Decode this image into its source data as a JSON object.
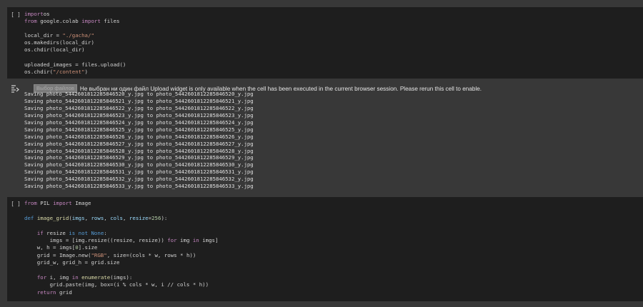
{
  "cell1": {
    "run_label": "[ ]",
    "lines": [
      [
        [
          "kw",
          "import"
        ],
        [
          "",
          "os"
        ]
      ],
      [
        [
          "kw",
          "from"
        ],
        [
          "",
          " google.colab "
        ],
        [
          "kw",
          "import"
        ],
        [
          "",
          " files"
        ]
      ],
      [],
      [
        [
          "",
          "local_dir = "
        ],
        [
          "str",
          "\"./gacha/\""
        ]
      ],
      [
        [
          "",
          "os.makedirs(local_dir)"
        ]
      ],
      [
        [
          "",
          "os.chdir(local_dir)"
        ]
      ],
      [],
      [
        [
          "",
          "uploaded_images = files.upload()"
        ]
      ],
      [
        [
          "",
          "os.chdir("
        ],
        [
          "str",
          "\"/content\""
        ],
        [
          "",
          ")"
        ]
      ]
    ]
  },
  "output": {
    "file_button": "Выбор файлов",
    "file_status": "Не выбран ни один файл",
    "upload_message": "Upload widget is only available when the cell has been executed in the current browser session. Please rerun this cell to enable.",
    "saving_lines": [
      "Saving photo_5442601812285846520_y.jpg to photo_5442601812285846520_y.jpg",
      "Saving photo_5442601812285846521_y.jpg to photo_5442601812285846521_y.jpg",
      "Saving photo_5442601812285846522_y.jpg to photo_5442601812285846522_y.jpg",
      "Saving photo_5442601812285846523_y.jpg to photo_5442601812285846523_y.jpg",
      "Saving photo_5442601812285846524_y.jpg to photo_5442601812285846524_y.jpg",
      "Saving photo_5442601812285846525_y.jpg to photo_5442601812285846525_y.jpg",
      "Saving photo_5442601812285846526_y.jpg to photo_5442601812285846526_y.jpg",
      "Saving photo_5442601812285846527_y.jpg to photo_5442601812285846527_y.jpg",
      "Saving photo_5442601812285846528_y.jpg to photo_5442601812285846528_y.jpg",
      "Saving photo_5442601812285846529_y.jpg to photo_5442601812285846529_y.jpg",
      "Saving photo_5442601812285846530_y.jpg to photo_5442601812285846530_y.jpg",
      "Saving photo_5442601812285846531_y.jpg to photo_5442601812285846531_y.jpg",
      "Saving photo_5442601812285846532_y.jpg to photo_5442601812285846532_y.jpg",
      "Saving photo_5442601812285846533_y.jpg to photo_5442601812285846533_y.jpg"
    ]
  },
  "cell2": {
    "run_label": "[ ]",
    "lines": [
      [
        [
          "kw",
          "from"
        ],
        [
          "",
          " PIL "
        ],
        [
          "kw",
          "import"
        ],
        [
          "",
          " Image"
        ]
      ],
      [],
      [
        [
          "kw2",
          "def"
        ],
        [
          "",
          " "
        ],
        [
          "fn",
          "image_grid"
        ],
        [
          "",
          "("
        ],
        [
          "vr",
          "imgs"
        ],
        [
          "",
          ", "
        ],
        [
          "vr",
          "rows"
        ],
        [
          "",
          ", "
        ],
        [
          "vr",
          "cols"
        ],
        [
          "",
          ", "
        ],
        [
          "vr",
          "resize"
        ],
        [
          "",
          "="
        ],
        [
          "num",
          "256"
        ],
        [
          "",
          "):"
        ]
      ],
      [],
      [
        [
          "",
          "    "
        ],
        [
          "kw",
          "if"
        ],
        [
          "",
          " resize "
        ],
        [
          "kw2",
          "is not"
        ],
        [
          "",
          " "
        ],
        [
          "kw2",
          "None"
        ],
        [
          "",
          ":"
        ]
      ],
      [
        [
          "",
          "        imgs = [img.resize((resize, resize)) "
        ],
        [
          "kw",
          "for"
        ],
        [
          "",
          " img "
        ],
        [
          "kw",
          "in"
        ],
        [
          "",
          " imgs]"
        ]
      ],
      [
        [
          "",
          "    w, h = imgs["
        ],
        [
          "num",
          "0"
        ],
        [
          "",
          "].size"
        ]
      ],
      [
        [
          "",
          "    grid = Image.new("
        ],
        [
          "str",
          "\"RGB\""
        ],
        [
          "",
          ", size=(cols * w, rows * h))"
        ]
      ],
      [
        [
          "",
          "    grid_w, grid_h = grid.size"
        ]
      ],
      [],
      [
        [
          "",
          "    "
        ],
        [
          "kw",
          "for"
        ],
        [
          "",
          " i, img "
        ],
        [
          "kw",
          "in"
        ],
        [
          "",
          " "
        ],
        [
          "fn",
          "enumerate"
        ],
        [
          "",
          "(imgs):"
        ]
      ],
      [
        [
          "",
          "        grid.paste(img, box=(i % cols * w, i // cols * h))"
        ]
      ],
      [
        [
          "",
          "    "
        ],
        [
          "kw",
          "return"
        ],
        [
          "",
          " grid"
        ]
      ]
    ]
  }
}
